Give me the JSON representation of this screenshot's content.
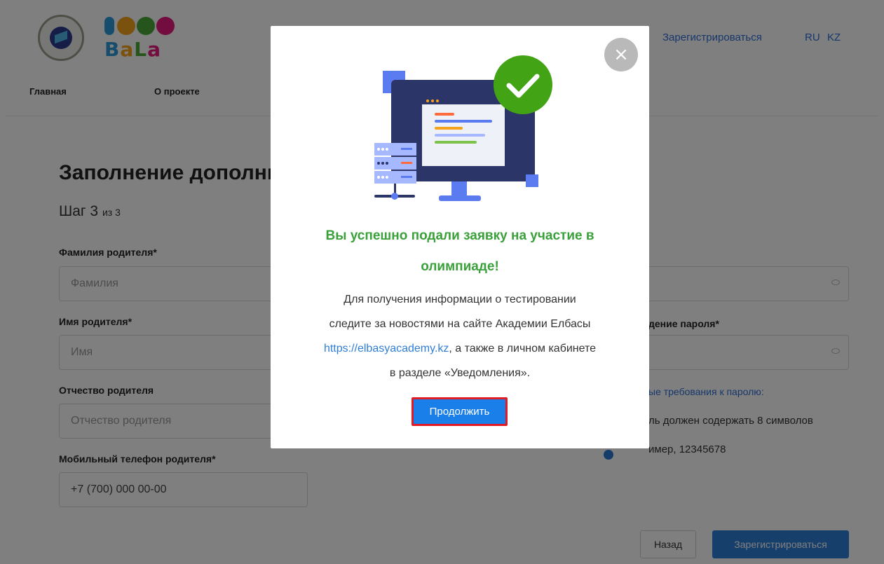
{
  "header": {
    "register_link": "Зарегистрироваться",
    "lang_ru": "RU",
    "lang_kz": "KZ",
    "logo_text": "BaLa"
  },
  "subnav": {
    "home": "Главная",
    "about": "О проекте"
  },
  "form": {
    "title": "Заполнение дополнительной информации",
    "step_label": "Шаг 3",
    "step_of": "из 3",
    "parent_surname_label": "Фамилия родителя*",
    "parent_surname_placeholder": "Фамилия",
    "parent_name_label": "Имя родителя*",
    "parent_name_placeholder": "Имя",
    "parent_patronymic_label": "Отчество родителя",
    "parent_patronymic_placeholder": "Отчество родителя",
    "parent_phone_label": "Мобильный телефон родителя*",
    "parent_phone_value": "+7 (700) 000 00-00",
    "password_confirm_label": "дение пароля*",
    "password_req_link": "ые требования к паролю:",
    "password_req_1": "ль должен содержать 8 символов",
    "password_req_2": "имер, 12345678",
    "back_button": "Назад",
    "submit_button": "Зарегистрироваться"
  },
  "modal": {
    "close_symbol": "×",
    "title_line1": "Вы успешно подали заявку на участие в",
    "title_line2": "олимпиаде!",
    "text_line1": "Для получения информации о тестировании",
    "text_line2": "следите за новостями на сайте Академии Елбасы",
    "link": "https://elbasyacademy.kz",
    "text_line3_suffix": ", а также в личном кабинете",
    "text_line4": "в разделе «Уведомления».",
    "continue_button": "Продолжить"
  },
  "colors": {
    "accent_blue": "#2f7ed8",
    "success_green": "#3aa13a",
    "highlight_red": "#e01b24"
  }
}
